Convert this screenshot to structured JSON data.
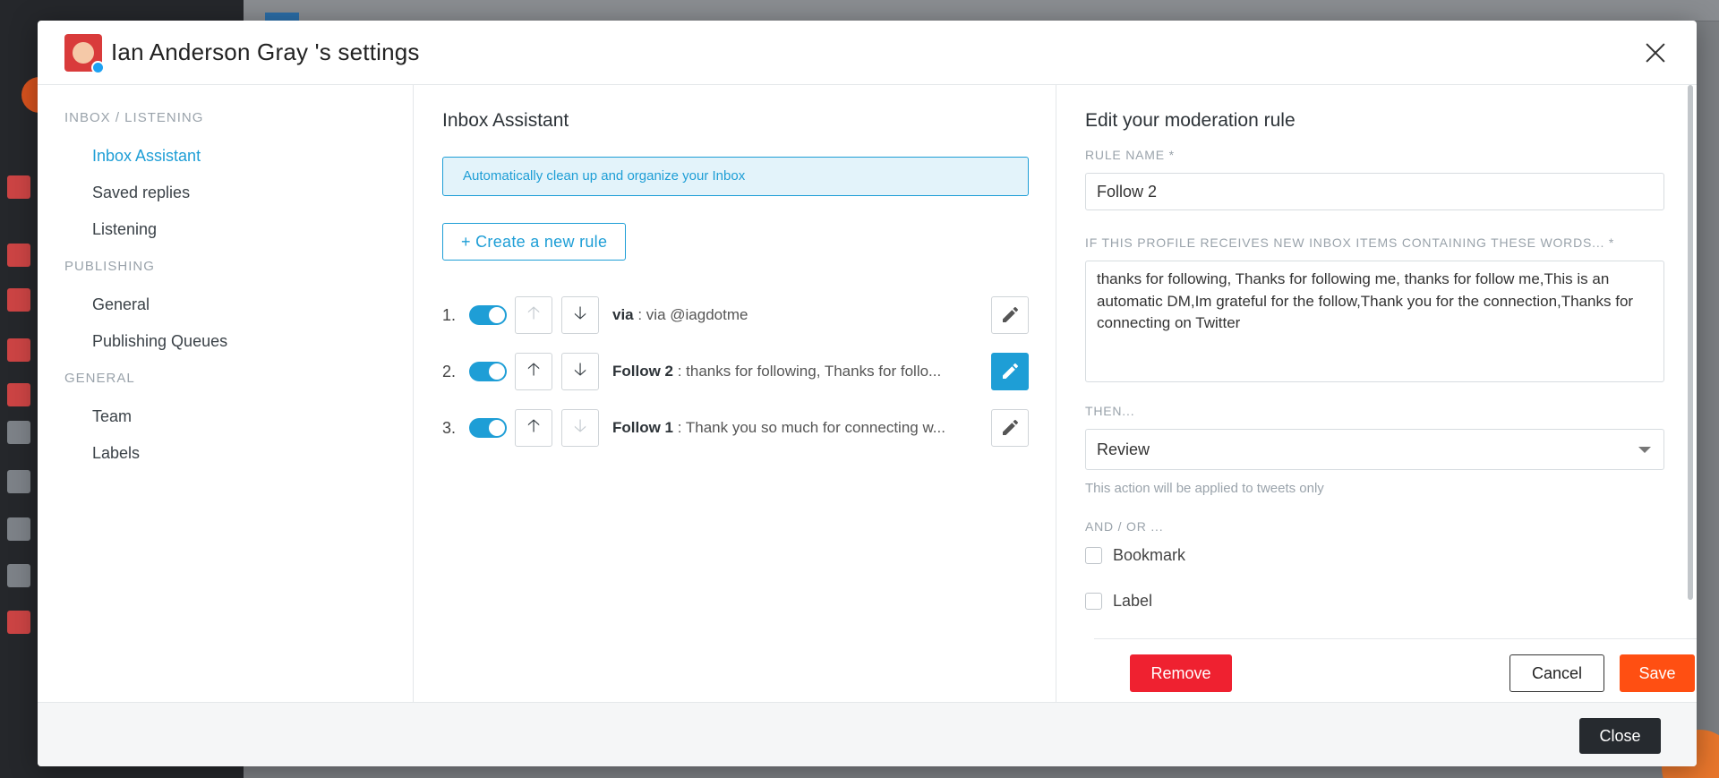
{
  "modal": {
    "title": "Ian Anderson Gray 's settings",
    "close_label": "Close"
  },
  "nav": {
    "sections": [
      {
        "label": "INBOX / LISTENING",
        "items": [
          "Inbox Assistant",
          "Saved replies",
          "Listening"
        ]
      },
      {
        "label": "PUBLISHING",
        "items": [
          "General",
          "Publishing Queues"
        ]
      },
      {
        "label": "GENERAL",
        "items": [
          "Team",
          "Labels"
        ]
      }
    ],
    "active_item": "Inbox Assistant"
  },
  "inbox_assistant": {
    "title": "Inbox Assistant",
    "info": "Automatically clean up and organize your Inbox",
    "create_label": "+ Create a new rule",
    "rules": [
      {
        "num": "1.",
        "name": "via",
        "text": " : via @iagdotme",
        "enabled": true,
        "up_disabled": true,
        "down_disabled": false,
        "editing": false
      },
      {
        "num": "2.",
        "name": "Follow 2",
        "text": " : thanks for following, Thanks for follo...",
        "enabled": true,
        "up_disabled": false,
        "down_disabled": false,
        "editing": true
      },
      {
        "num": "3.",
        "name": "Follow 1",
        "text": " : Thank you so much for connecting w...",
        "enabled": true,
        "up_disabled": false,
        "down_disabled": true,
        "editing": false
      }
    ]
  },
  "edit_rule": {
    "title": "Edit your moderation rule",
    "rule_name_label": "RULE NAME *",
    "rule_name_value": "Follow 2",
    "words_label": "IF THIS PROFILE RECEIVES NEW INBOX ITEMS CONTAINING THESE WORDS... *",
    "words_value": "thanks for following, Thanks for following me, thanks for follow me,This is an automatic DM,Im grateful for the follow,Thank you for the connection,Thanks for connecting on Twitter",
    "then_label": "THEN...",
    "then_value": "Review",
    "then_hint": "This action will be applied to tweets only",
    "andor_label": "AND / OR ...",
    "options": [
      {
        "label": "Bookmark",
        "checked": false
      },
      {
        "label": "Label",
        "checked": false
      }
    ],
    "remove_label": "Remove",
    "cancel_label": "Cancel",
    "save_label": "Save"
  },
  "colors": {
    "accent": "#1e9ed6",
    "remove": "#ef2130",
    "save": "#ff4f12",
    "close": "#262a2f"
  }
}
